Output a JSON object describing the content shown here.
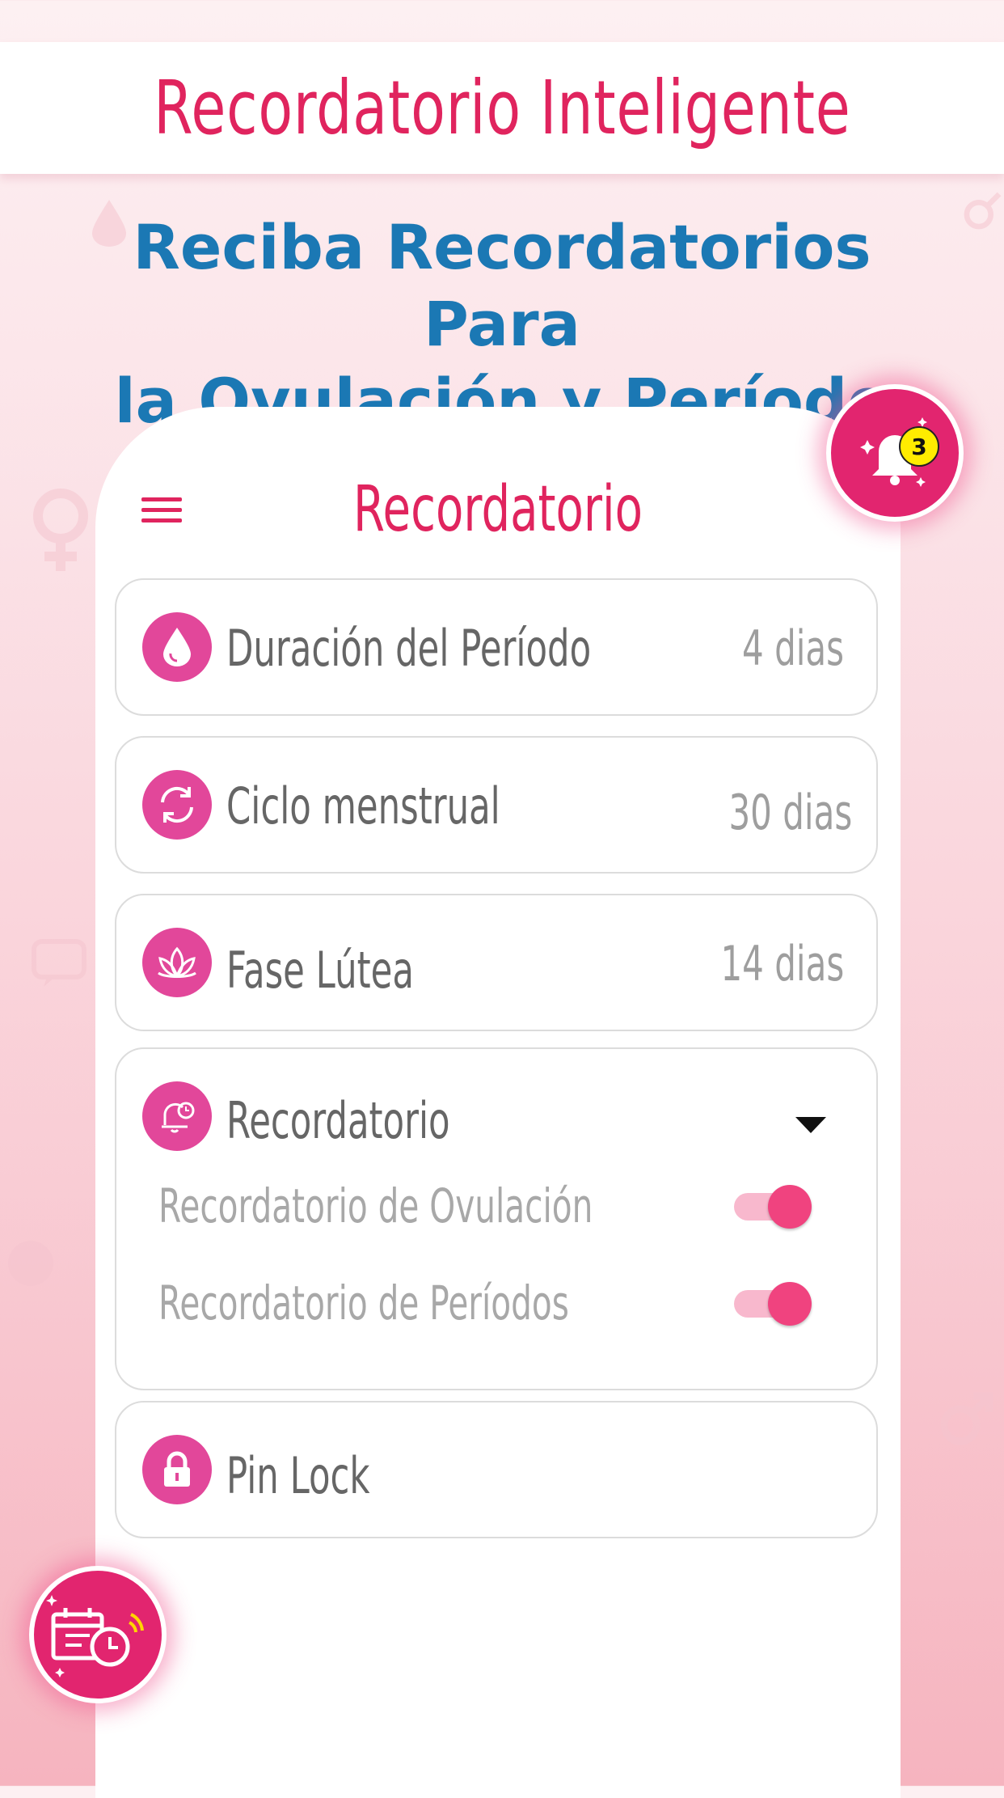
{
  "banner": {
    "title": "Recordatorio Inteligente"
  },
  "subtitle": {
    "line1": "Reciba Recordatorios Para",
    "line2": "la Ovulación y Período"
  },
  "screen": {
    "title": "Recordatorio"
  },
  "settings": [
    {
      "label": "Duración del Período",
      "value": "4 dias",
      "icon": "drop-icon"
    },
    {
      "label": "Ciclo menstrual",
      "value": "30 dias",
      "icon": "cycle-icon"
    },
    {
      "label": "Fase Lútea",
      "value": "14 dias",
      "icon": "lotus-icon"
    }
  ],
  "reminder": {
    "label": "Recordatorio",
    "icon": "alarm-bell-icon",
    "options": [
      {
        "label": "Recordatorio de Ovulación",
        "enabled": true
      },
      {
        "label": "Recordatorio de Períodos",
        "enabled": true
      }
    ]
  },
  "pin_lock": {
    "label": "Pin Lock",
    "icon": "lock-icon"
  },
  "notification_badge": {
    "count": "3"
  },
  "colors": {
    "accent": "#e0245e",
    "subtitle": "#1b78b4",
    "icon_bg": "#e2479a",
    "toggle": "#f0437f"
  }
}
